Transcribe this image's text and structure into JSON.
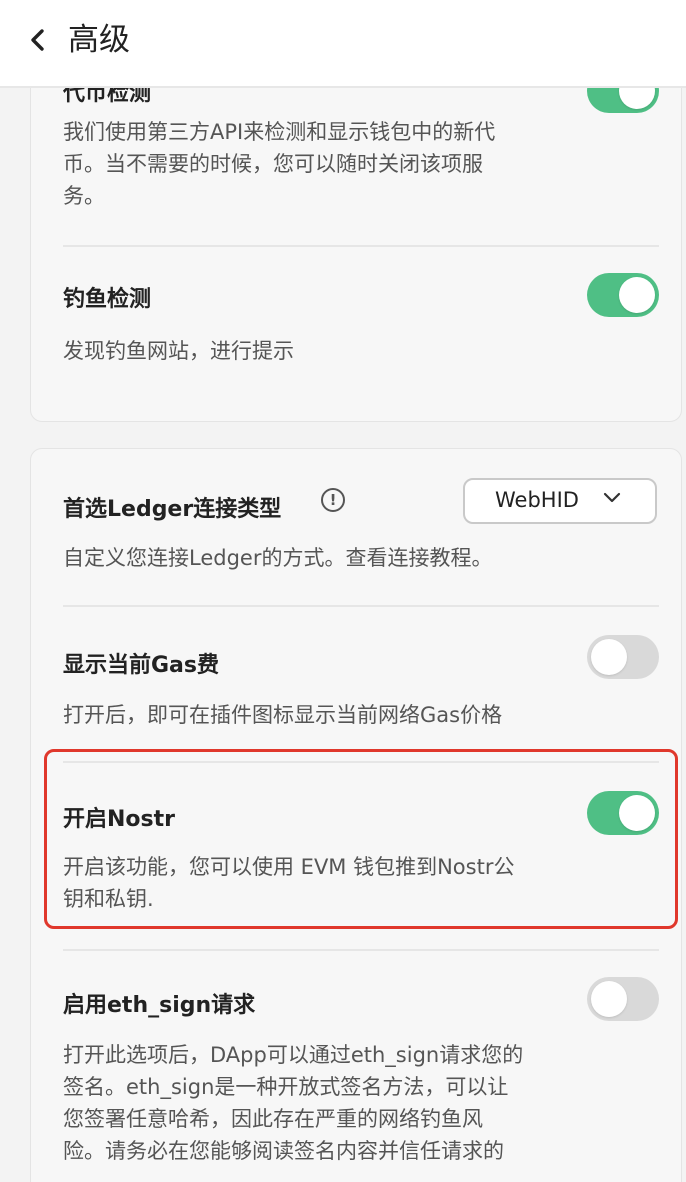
{
  "header": {
    "title": "高级",
    "back_icon": "chevron-left-icon"
  },
  "colors": {
    "toggle_on": "#4fbf85",
    "toggle_off": "#d9d9d9",
    "highlight": "#e0382c"
  },
  "sections": {
    "token_detect": {
      "title": "代币检测",
      "desc_lines": [
        "我们使用第三方API来检测和显示钱包中的新代",
        "币。当不需要的时候，您可以随时关闭该项服",
        "务。"
      ],
      "enabled": true
    },
    "phishing_detect": {
      "title": "钓鱼检测",
      "desc": "发现钓鱼网站，进行提示",
      "enabled": true
    },
    "ledger": {
      "title": "首选Ledger连接类型",
      "info_icon": "info-icon",
      "select_value": "WebHID",
      "desc": "自定义您连接Ledger的方式。查看连接教程。"
    },
    "gas_fee": {
      "title": "显示当前Gas费",
      "desc": "打开后，即可在插件图标显示当前网络Gas价格",
      "enabled": false
    },
    "nostr": {
      "title": "开启Nostr",
      "desc_lines": [
        "开启该功能，您可以使用 EVM 钱包推到Nostr公",
        "钥和私钥."
      ],
      "enabled": true
    },
    "eth_sign": {
      "title": "启用eth_sign请求",
      "desc_lines": [
        "打开此选项后，DApp可以通过eth_sign请求您的",
        "签名。eth_sign是一种开放式签名方法，可以让",
        "您签署任意哈希，因此存在严重的网络钓鱼风",
        "险。请务必在您能够阅读签名内容并信任请求的"
      ],
      "enabled": false
    }
  }
}
